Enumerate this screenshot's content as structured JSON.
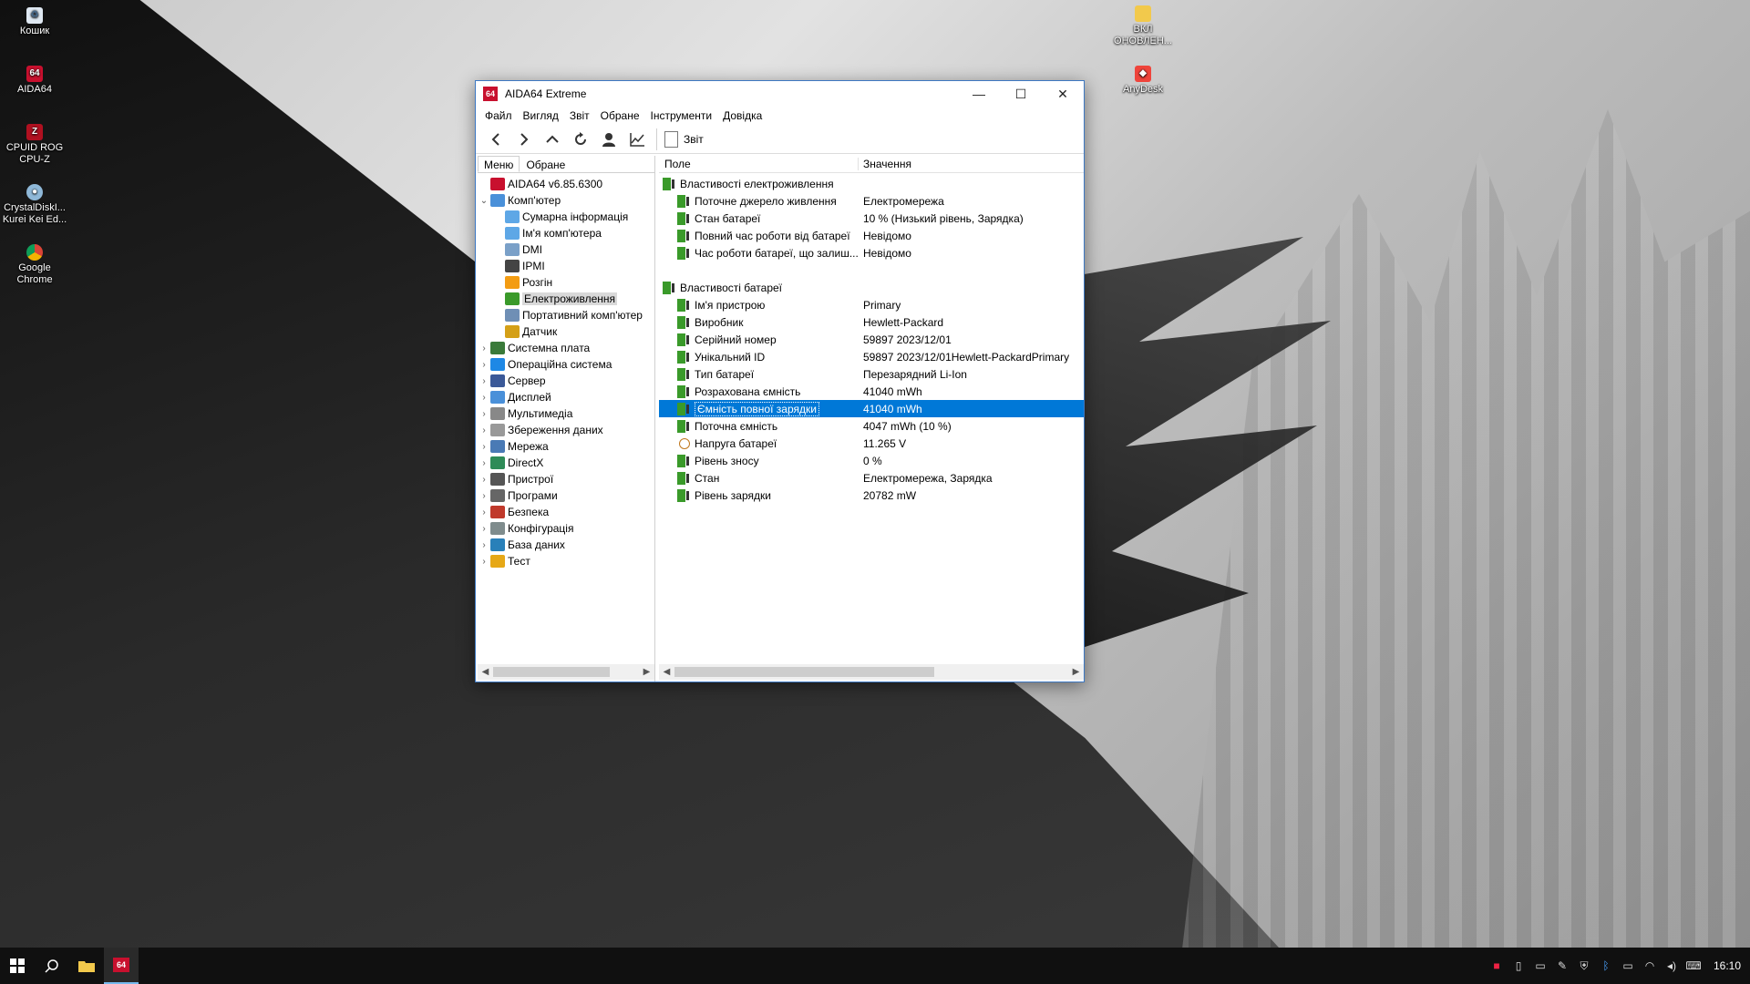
{
  "desktop": {
    "icons": [
      {
        "label": "Кошик"
      },
      {
        "label": "AIDA64"
      },
      {
        "label": "CPUID ROG CPU-Z"
      },
      {
        "label": "CrystalDiskI... Kurei Kei Ed..."
      },
      {
        "label": "Google Chrome"
      },
      {
        "label": "ВКЛ ОНОВЛЕН..."
      },
      {
        "label": "AnyDesk"
      }
    ]
  },
  "window": {
    "title": "AIDA64 Extreme",
    "logo": "64",
    "controls": {
      "minimize": "—",
      "maximize": "☐",
      "close": "✕"
    },
    "menu": [
      "Файл",
      "Вигляд",
      "Звіт",
      "Обране",
      "Інструменти",
      "Довідка"
    ],
    "toolbar": {
      "report_label": "Звіт",
      "buttons": [
        "back-icon",
        "forward-icon",
        "up-icon",
        "refresh-icon",
        "user-icon",
        "chart-icon"
      ]
    },
    "left_panel": {
      "tabs": [
        "Меню",
        "Обране"
      ],
      "tree": [
        {
          "label": "AIDA64 v6.85.6300",
          "exp": "",
          "icon": "aida-icon"
        },
        {
          "label": "Комп'ютер",
          "exp": "v",
          "icon": "computer-icon"
        },
        {
          "label": "Сумарна інформація",
          "exp": "",
          "icon": "summary-icon"
        },
        {
          "label": "Ім'я комп'ютера",
          "exp": "",
          "icon": "computer-name-icon"
        },
        {
          "label": "DMI",
          "exp": "",
          "icon": "dmi-icon"
        },
        {
          "label": "IPMI",
          "exp": "",
          "icon": "ipmi-icon"
        },
        {
          "label": "Розгін",
          "exp": "",
          "icon": "overclock-icon"
        },
        {
          "label": "Електроживлення",
          "exp": "",
          "icon": "power-icon"
        },
        {
          "label": "Портативний комп'ютер",
          "exp": "",
          "icon": "laptop-icon"
        },
        {
          "label": "Датчик",
          "exp": "",
          "icon": "sensor-icon"
        },
        {
          "label": "Системна плата",
          "exp": ">",
          "icon": "motherboard-icon"
        },
        {
          "label": "Операційна система",
          "exp": ">",
          "icon": "windows-icon"
        },
        {
          "label": "Сервер",
          "exp": ">",
          "icon": "server-icon"
        },
        {
          "label": "Дисплей",
          "exp": ">",
          "icon": "display-icon"
        },
        {
          "label": "Мультимедіа",
          "exp": ">",
          "icon": "multimedia-icon"
        },
        {
          "label": "Збереження даних",
          "exp": ">",
          "icon": "storage-icon"
        },
        {
          "label": "Мережа",
          "exp": ">",
          "icon": "network-icon"
        },
        {
          "label": "DirectX",
          "exp": ">",
          "icon": "directx-icon"
        },
        {
          "label": "Пристрої",
          "exp": ">",
          "icon": "devices-icon"
        },
        {
          "label": "Програми",
          "exp": ">",
          "icon": "programs-icon"
        },
        {
          "label": "Безпека",
          "exp": ">",
          "icon": "security-icon"
        },
        {
          "label": "Конфігурація",
          "exp": ">",
          "icon": "config-icon"
        },
        {
          "label": "База даних",
          "exp": ">",
          "icon": "database-icon"
        },
        {
          "label": "Тест",
          "exp": ">",
          "icon": "test-icon"
        }
      ],
      "selected_index": 7
    },
    "right_panel": {
      "headers": {
        "field": "Поле",
        "value": "Значення"
      },
      "rows": [
        {
          "type": "section",
          "field": "Властивості електроживлення",
          "value": ""
        },
        {
          "type": "item",
          "field": "Поточне джерело живлення",
          "value": "Електромережа"
        },
        {
          "type": "item",
          "field": "Стан батареї",
          "value": "10 % (Низький рівень, Зарядка)"
        },
        {
          "type": "item",
          "field": "Повний час роботи від батареї",
          "value": "Невідомо"
        },
        {
          "type": "item",
          "field": "Час роботи батареї, що залиш...",
          "value": "Невідомо"
        },
        {
          "type": "spacer",
          "field": "",
          "value": ""
        },
        {
          "type": "section",
          "field": "Властивості батареї",
          "value": ""
        },
        {
          "type": "item",
          "field": "Ім'я пристрою",
          "value": "Primary"
        },
        {
          "type": "item",
          "field": "Виробник",
          "value": "Hewlett-Packard"
        },
        {
          "type": "item",
          "field": "Серійний номер",
          "value": "59897 2023/12/01"
        },
        {
          "type": "item",
          "field": "Унікальний ID",
          "value": "59897 2023/12/01Hewlett-PackardPrimary"
        },
        {
          "type": "item",
          "field": "Тип батареї",
          "value": "Перезарядний Li-Ion"
        },
        {
          "type": "item",
          "field": "Розрахована ємність",
          "value": "41040 mWh"
        },
        {
          "type": "item",
          "field": "Ємність повної зарядки",
          "value": "41040 mWh",
          "selected": true
        },
        {
          "type": "item",
          "field": "Поточна ємність",
          "value": "4047 mWh  (10 %)"
        },
        {
          "type": "volt",
          "field": "Напруга батареї",
          "value": "11.265 V"
        },
        {
          "type": "item",
          "field": "Рівень зносу",
          "value": "0 %"
        },
        {
          "type": "item",
          "field": "Стан",
          "value": "Електромережа, Зарядка"
        },
        {
          "type": "item",
          "field": "Рівень зарядки",
          "value": "20782 mW"
        }
      ]
    }
  },
  "taskbar": {
    "items": [
      "start-icon",
      "search-icon",
      "explorer-icon",
      "aida64-taskbar-icon"
    ],
    "active_label": "64",
    "clock": "16:10",
    "tray": [
      "aida-tray-icon",
      "usb-icon",
      "display-tray-icon",
      "pen-icon",
      "windows-security-icon",
      "bluetooth-icon",
      "battery-icon",
      "wifi-icon",
      "volume-icon",
      "keyboard-icon"
    ]
  },
  "colors": {
    "selection": "#0078d7",
    "accent_red": "#c8102e",
    "taskbar": "#101010"
  }
}
